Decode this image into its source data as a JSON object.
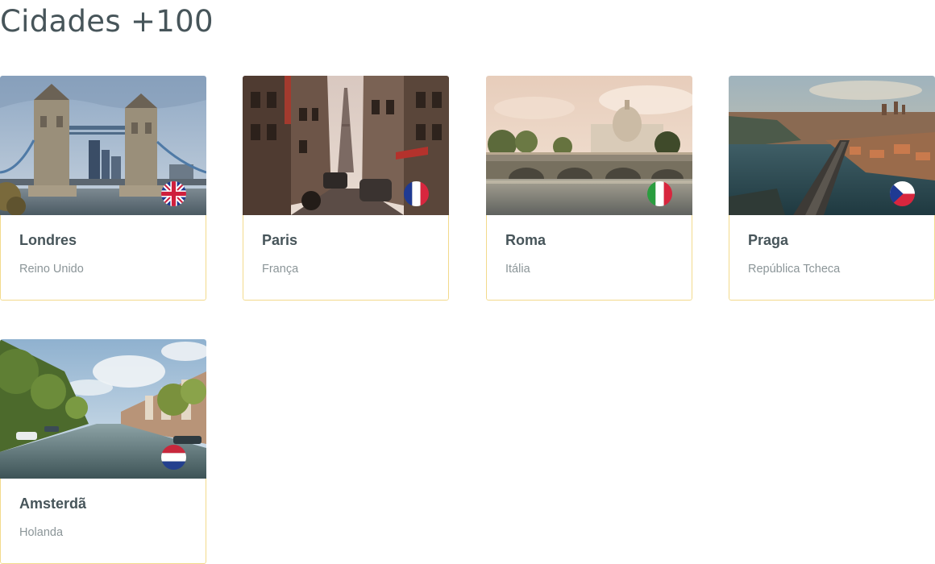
{
  "page": {
    "title": "Cidades +100"
  },
  "cities": [
    {
      "name": "Londres",
      "country": "Reino Unido",
      "flag_icon": "uk-flag-icon",
      "image": "tower-bridge-photo"
    },
    {
      "name": "Paris",
      "country": "França",
      "flag_icon": "france-flag-icon",
      "image": "paris-street-photo"
    },
    {
      "name": "Roma",
      "country": "Itália",
      "flag_icon": "italy-flag-icon",
      "image": "rome-river-photo"
    },
    {
      "name": "Praga",
      "country": "República Tcheca",
      "flag_icon": "czech-flag-icon",
      "image": "prague-aerial-photo"
    },
    {
      "name": "Amsterdã",
      "country": "Holanda",
      "flag_icon": "netherlands-flag-icon",
      "image": "amsterdam-canal-photo"
    }
  ],
  "colors": {
    "title_text": "#47555a",
    "city_text": "#47555a",
    "country_text": "#8b9598",
    "card_border": "#f3da8c"
  }
}
